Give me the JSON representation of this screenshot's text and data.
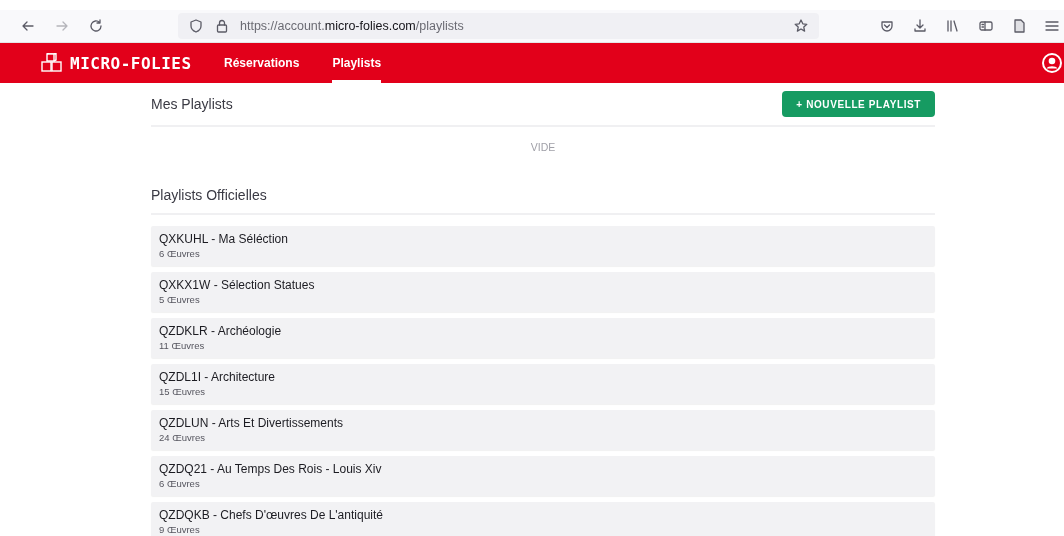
{
  "browser": {
    "url": {
      "prefix": "https://account.",
      "domain": "micro-folies.com",
      "path": "/playlists"
    }
  },
  "header": {
    "logo": "MICRO-FOLIES",
    "tabs": [
      {
        "label": "Réservations",
        "selected": false
      },
      {
        "label": "Playlists",
        "selected": true
      }
    ]
  },
  "my_playlists": {
    "title": "Mes Playlists",
    "button": "+ NOUVELLE PLAYLIST",
    "empty": "VIDE"
  },
  "official_playlists": {
    "title": "Playlists Officielles",
    "items": [
      {
        "name": "QXKUHL - Ma Séléction",
        "count": "6 Œuvres"
      },
      {
        "name": "QXKX1W - Sélection Statues",
        "count": "5 Œuvres"
      },
      {
        "name": "QZDKLR - Archéologie",
        "count": "11 Œuvres"
      },
      {
        "name": "QZDL1I - Architecture",
        "count": "15 Œuvres"
      },
      {
        "name": "QZDLUN - Arts Et Divertissements",
        "count": "24 Œuvres"
      },
      {
        "name": "QZDQ21 - Au Temps Des Rois - Louis Xiv",
        "count": "6 Œuvres"
      },
      {
        "name": "QZDQKB - Chefs D'œuvres De L'antiquité",
        "count": "9 Œuvres"
      }
    ]
  }
}
